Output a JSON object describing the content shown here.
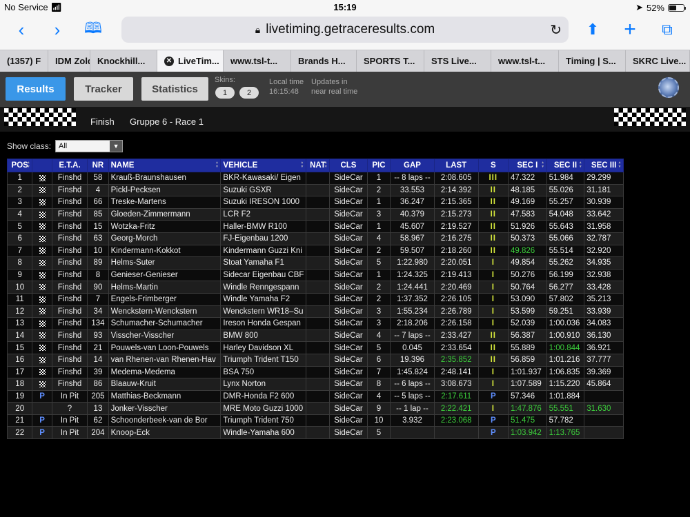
{
  "status": {
    "carrier": "No Service",
    "time": "15:19",
    "battery": "52%",
    "battery_fraction": 0.52
  },
  "browser": {
    "url": "livetiming.getraceresults.com",
    "tabs": [
      "(1357) F",
      "IDM Zold",
      "Knockhill...",
      "LiveTim...",
      "www.tsl-t...",
      "Brands H...",
      "SPORTS T...",
      "STS Live...",
      "www.tsl-t...",
      "Timing | S...",
      "SKRC Live..."
    ],
    "active_tab": 3
  },
  "app": {
    "nav": {
      "results": "Results",
      "tracker": "Tracker",
      "statistics": "Statistics"
    },
    "skins_label": "Skins:",
    "skins": [
      "1",
      "2"
    ],
    "local_time_label": "Local time",
    "local_time": "16:15:48",
    "updates_line1": "Updates in",
    "updates_line2": "near real time",
    "finish_status": "Finish",
    "session": "Gruppe 6 - Race 1",
    "show_class_label": "Show class:",
    "class_value": "All"
  },
  "table": {
    "columns": [
      "POS",
      "",
      "E.T.A.",
      "NR",
      "NAME",
      "VEHICLE",
      "NAT",
      "CLS",
      "PIC",
      "GAP",
      "LAST",
      "S",
      "SEC I",
      "SEC II",
      "SEC III"
    ],
    "rows": [
      {
        "pos": "1",
        "flag": "chk",
        "eta": "Finshd",
        "nr": "58",
        "name": "Krauß-Braunshausen",
        "vehicle": "BKR-Kawasaki/ Eigen",
        "nat": "",
        "cls": "SideCar",
        "pic": "1",
        "gap": "-- 8 laps --",
        "last": "2:08.605",
        "last_g": false,
        "s": "III",
        "s1": "47.322",
        "s1_g": false,
        "s2": "51.984",
        "s2_g": false,
        "s3": "29.299",
        "s3_g": false
      },
      {
        "pos": "2",
        "flag": "chk",
        "eta": "Finshd",
        "nr": "4",
        "name": "Pickl-Pecksen",
        "vehicle": "Suzuki GSXR",
        "nat": "",
        "cls": "SideCar",
        "pic": "2",
        "gap": "33.553",
        "last": "2:14.392",
        "last_g": false,
        "s": "II",
        "s1": "48.185",
        "s1_g": false,
        "s2": "55.026",
        "s2_g": false,
        "s3": "31.181",
        "s3_g": false
      },
      {
        "pos": "3",
        "flag": "chk",
        "eta": "Finshd",
        "nr": "66",
        "name": "Treske-Martens",
        "vehicle": "Suzuki IRESON 1000",
        "nat": "",
        "cls": "SideCar",
        "pic": "1",
        "gap": "36.247",
        "last": "2:15.365",
        "last_g": false,
        "s": "II",
        "s1": "49.169",
        "s1_g": false,
        "s2": "55.257",
        "s2_g": false,
        "s3": "30.939",
        "s3_g": false
      },
      {
        "pos": "4",
        "flag": "chk",
        "eta": "Finshd",
        "nr": "85",
        "name": "Gloeden-Zimmermann",
        "vehicle": "LCR F2",
        "nat": "",
        "cls": "SideCar",
        "pic": "3",
        "gap": "40.379",
        "last": "2:15.273",
        "last_g": false,
        "s": "II",
        "s1": "47.583",
        "s1_g": false,
        "s2": "54.048",
        "s2_g": false,
        "s3": "33.642",
        "s3_g": false
      },
      {
        "pos": "5",
        "flag": "chk",
        "eta": "Finshd",
        "nr": "15",
        "name": "Wotzka-Fritz",
        "vehicle": "Haller-BMW R100",
        "nat": "",
        "cls": "SideCar",
        "pic": "1",
        "gap": "45.607",
        "last": "2:19.527",
        "last_g": false,
        "s": "II",
        "s1": "51.926",
        "s1_g": false,
        "s2": "55.643",
        "s2_g": false,
        "s3": "31.958",
        "s3_g": false
      },
      {
        "pos": "6",
        "flag": "chk",
        "eta": "Finshd",
        "nr": "63",
        "name": "Georg-Morch",
        "vehicle": "FJ-Eigenbau 1200",
        "nat": "",
        "cls": "SideCar",
        "pic": "4",
        "gap": "58.967",
        "last": "2:16.275",
        "last_g": false,
        "s": "II",
        "s1": "50.373",
        "s1_g": false,
        "s2": "55.066",
        "s2_g": false,
        "s3": "32.787",
        "s3_g": false
      },
      {
        "pos": "7",
        "flag": "chk",
        "eta": "Finshd",
        "nr": "10",
        "name": "Kindermann-Kokkot",
        "vehicle": "Kindermann Guzzi Kni",
        "nat": "",
        "cls": "SideCar",
        "pic": "2",
        "gap": "59.507",
        "last": "2:18.260",
        "last_g": false,
        "s": "II",
        "s1": "49.826",
        "s1_g": true,
        "s2": "55.514",
        "s2_g": false,
        "s3": "32.920",
        "s3_g": false
      },
      {
        "pos": "8",
        "flag": "chk",
        "eta": "Finshd",
        "nr": "89",
        "name": "Helms-Suter",
        "vehicle": "Stoat Yamaha F1",
        "nat": "",
        "cls": "SideCar",
        "pic": "5",
        "gap": "1:22.980",
        "last": "2:20.051",
        "last_g": false,
        "s": "I",
        "s1": "49.854",
        "s1_g": false,
        "s2": "55.262",
        "s2_g": false,
        "s3": "34.935",
        "s3_g": false
      },
      {
        "pos": "9",
        "flag": "chk",
        "eta": "Finshd",
        "nr": "8",
        "name": "Genieser-Genieser",
        "vehicle": "Sidecar Eigenbau CBF",
        "nat": "",
        "cls": "SideCar",
        "pic": "1",
        "gap": "1:24.325",
        "last": "2:19.413",
        "last_g": false,
        "s": "I",
        "s1": "50.276",
        "s1_g": false,
        "s2": "56.199",
        "s2_g": false,
        "s3": "32.938",
        "s3_g": false
      },
      {
        "pos": "10",
        "flag": "chk",
        "eta": "Finshd",
        "nr": "90",
        "name": "Helms-Martin",
        "vehicle": "Windle Renngespann",
        "nat": "",
        "cls": "SideCar",
        "pic": "2",
        "gap": "1:24.441",
        "last": "2:20.469",
        "last_g": false,
        "s": "I",
        "s1": "50.764",
        "s1_g": false,
        "s2": "56.277",
        "s2_g": false,
        "s3": "33.428",
        "s3_g": false
      },
      {
        "pos": "11",
        "flag": "chk",
        "eta": "Finshd",
        "nr": "7",
        "name": "Engels-Frimberger",
        "vehicle": "Windle Yamaha F2",
        "nat": "",
        "cls": "SideCar",
        "pic": "2",
        "gap": "1:37.352",
        "last": "2:26.105",
        "last_g": false,
        "s": "I",
        "s1": "53.090",
        "s1_g": false,
        "s2": "57.802",
        "s2_g": false,
        "s3": "35.213",
        "s3_g": false
      },
      {
        "pos": "12",
        "flag": "chk",
        "eta": "Finshd",
        "nr": "34",
        "name": "Wenckstern-Wenckstern",
        "vehicle": "Wenckstern WR18–Su",
        "nat": "",
        "cls": "SideCar",
        "pic": "3",
        "gap": "1:55.234",
        "last": "2:26.789",
        "last_g": false,
        "s": "I",
        "s1": "53.599",
        "s1_g": false,
        "s2": "59.251",
        "s2_g": false,
        "s3": "33.939",
        "s3_g": false
      },
      {
        "pos": "13",
        "flag": "chk",
        "eta": "Finshd",
        "nr": "134",
        "name": "Schumacher-Schumacher",
        "vehicle": "Ireson Honda Gespan",
        "nat": "",
        "cls": "SideCar",
        "pic": "3",
        "gap": "2:18.206",
        "last": "2:26.158",
        "last_g": false,
        "s": "I",
        "s1": "52.039",
        "s1_g": false,
        "s2": "1:00.036",
        "s2_g": false,
        "s3": "34.083",
        "s3_g": false
      },
      {
        "pos": "14",
        "flag": "chk",
        "eta": "Finshd",
        "nr": "93",
        "name": "Visscher-Visscher",
        "vehicle": "BMW 800",
        "nat": "",
        "cls": "SideCar",
        "pic": "4",
        "gap": "-- 7 laps --",
        "last": "2:33.427",
        "last_g": false,
        "s": "II",
        "s1": "56.387",
        "s1_g": false,
        "s2": "1:00.910",
        "s2_g": false,
        "s3": "36.130",
        "s3_g": false
      },
      {
        "pos": "15",
        "flag": "chk",
        "eta": "Finshd",
        "nr": "21",
        "name": "Pouwels-van Loon-Pouwels",
        "vehicle": "Harley Davidson XL",
        "nat": "",
        "cls": "SideCar",
        "pic": "5",
        "gap": "0.045",
        "last": "2:33.654",
        "last_g": false,
        "s": "II",
        "s1": "55.889",
        "s1_g": false,
        "s2": "1:00.844",
        "s2_g": true,
        "s3": "36.921",
        "s3_g": false
      },
      {
        "pos": "16",
        "flag": "chk",
        "eta": "Finshd",
        "nr": "14",
        "name": "van Rhenen-van Rhenen-Hav",
        "vehicle": "Triumph Trident T150",
        "nat": "",
        "cls": "SideCar",
        "pic": "6",
        "gap": "19.396",
        "last": "2:35.852",
        "last_g": true,
        "s": "II",
        "s1": "56.859",
        "s1_g": false,
        "s2": "1:01.216",
        "s2_g": false,
        "s3": "37.777",
        "s3_g": false
      },
      {
        "pos": "17",
        "flag": "chk",
        "eta": "Finshd",
        "nr": "39",
        "name": "Medema-Medema",
        "vehicle": "BSA 750",
        "nat": "",
        "cls": "SideCar",
        "pic": "7",
        "gap": "1:45.824",
        "last": "2:48.141",
        "last_g": false,
        "s": "I",
        "s1": "1:01.937",
        "s1_g": false,
        "s2": "1:06.835",
        "s2_g": false,
        "s3": "39.369",
        "s3_g": false
      },
      {
        "pos": "18",
        "flag": "chk",
        "eta": "Finshd",
        "nr": "86",
        "name": "Blaauw-Kruit",
        "vehicle": "Lynx Norton",
        "nat": "",
        "cls": "SideCar",
        "pic": "8",
        "gap": "-- 6 laps --",
        "last": "3:08.673",
        "last_g": false,
        "s": "I",
        "s1": "1:07.589",
        "s1_g": false,
        "s2": "1:15.220",
        "s2_g": false,
        "s3": "45.864",
        "s3_g": false
      },
      {
        "pos": "19",
        "flag": "P",
        "eta": "In Pit",
        "nr": "205",
        "name": "Matthias-Beckmann",
        "vehicle": "DMR-Honda F2 600",
        "nat": "",
        "cls": "SideCar",
        "pic": "4",
        "gap": "-- 5 laps --",
        "last": "2:17.611",
        "last_g": true,
        "s": "P",
        "s1": "57.346",
        "s1_g": false,
        "s2": "1:01.884",
        "s2_g": false,
        "s3": "",
        "s3_g": false
      },
      {
        "pos": "20",
        "flag": "",
        "eta": "?",
        "nr": "13",
        "name": "Jonker-Visscher",
        "vehicle": "MRE Moto Guzzi 1000",
        "nat": "",
        "cls": "SideCar",
        "pic": "9",
        "gap": "-- 1 lap --",
        "last": "2:22.421",
        "last_g": true,
        "s": "I",
        "s1": "1:47.876",
        "s1_g": true,
        "s2": "55.551",
        "s2_g": true,
        "s3": "31.630",
        "s3_g": true
      },
      {
        "pos": "21",
        "flag": "P",
        "eta": "In Pit",
        "nr": "62",
        "name": "Schoonderbeek-van de Bor",
        "vehicle": "Triumph Trident 750",
        "nat": "",
        "cls": "SideCar",
        "pic": "10",
        "gap": "3.932",
        "last": "2:23.068",
        "last_g": true,
        "s": "P",
        "s1": "51.475",
        "s1_g": true,
        "s2": "57.782",
        "s2_g": false,
        "s3": "",
        "s3_g": false
      },
      {
        "pos": "22",
        "flag": "P",
        "eta": "In Pit",
        "nr": "204",
        "name": "Knoop-Eck",
        "vehicle": "Windle-Yamaha 600",
        "nat": "",
        "cls": "SideCar",
        "pic": "5",
        "gap": "",
        "last": "",
        "last_g": false,
        "s": "P",
        "s1": "1:03.942",
        "s1_g": true,
        "s2": "1:13.765",
        "s2_g": true,
        "s3": "",
        "s3_g": false
      }
    ]
  },
  "colors": {
    "accent": "#3a97e8",
    "header_blue": "#1f2d9f",
    "best_green": "#3ccf3c",
    "sector_yellow": "#d6e83c",
    "pit_blue": "#5f8fff"
  },
  "icons": {
    "back": "chevron-left-icon",
    "forward": "chevron-right-icon",
    "bookmarks": "book-icon",
    "lock": "lock-icon",
    "reload": "reload-icon",
    "share": "share-icon",
    "add": "plus-icon",
    "tabs": "tabs-icon",
    "settings": "gear-icon"
  }
}
